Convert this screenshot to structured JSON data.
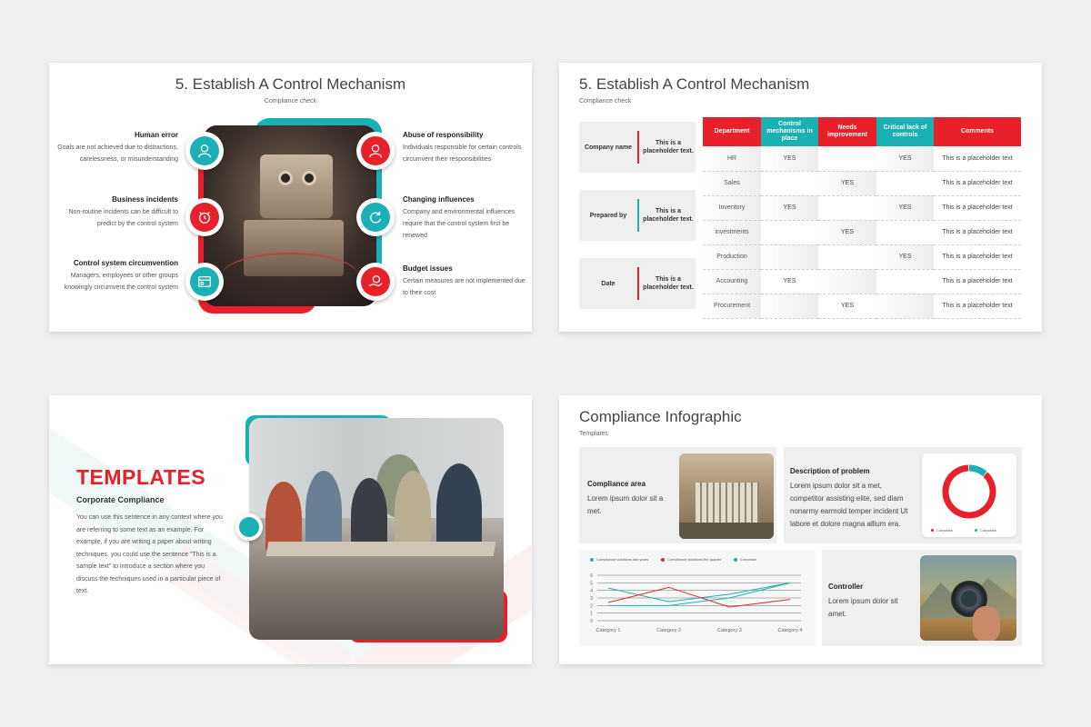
{
  "colors": {
    "teal": "#1ab0b4",
    "red": "#e8202a"
  },
  "slide1": {
    "title": "5. Establish A Control Mechanism",
    "subtitle": "Compliance check",
    "left_items": [
      {
        "heading": "Human error",
        "text": "Goals are not achieved due to distractions, carelessness, or misunderstanding",
        "icon": "person-icon"
      },
      {
        "heading": "Business incidents",
        "text": "Non-routine incidents can be difficult to predict by the control system",
        "icon": "alarm-icon"
      },
      {
        "heading": "Control system circumvention",
        "text": "Managers, employees or other groups knowingly circumvent the control system",
        "icon": "browser-icon"
      }
    ],
    "right_items": [
      {
        "heading": "Abuse of responsibility",
        "text": "Individuals responsible for certain controls circumvent their responsibilities",
        "icon": "person-icon"
      },
      {
        "heading": "Changing influences",
        "text": "Company and environmental influences require that the control system first be renewed",
        "icon": "refresh-icon"
      },
      {
        "heading": "Budget issues",
        "text": "Certain measures are not implemented due to their cost",
        "icon": "money-hand-icon"
      }
    ]
  },
  "slide2": {
    "title": "5. Establish A Control Mechanism",
    "subtitle": "Compliance check",
    "info_cards": [
      {
        "label": "Company name",
        "value": "This is a placeholder text."
      },
      {
        "label": "Prepared by",
        "value": "This is a placeholder text."
      },
      {
        "label": "Date",
        "value": "This is a placeholder text."
      }
    ],
    "table": {
      "headers": [
        "Department",
        "Control mechanisms in place",
        "Needs improvement",
        "Critical lack of controls",
        "Comments"
      ],
      "rows": [
        [
          "HR",
          "YES",
          "",
          "YES",
          "This is a placeholder text"
        ],
        [
          "Sales",
          "",
          "YES",
          "",
          "This is a placeholder text"
        ],
        [
          "Inventory",
          "YES",
          "",
          "YES",
          "This is a placeholder text"
        ],
        [
          "investments",
          "",
          "YES",
          "",
          "This is a placeholder text"
        ],
        [
          "Production",
          "",
          "",
          "YES",
          "This is a placeholder text"
        ],
        [
          "Accounting",
          "YES",
          "",
          "",
          "This is a placeholder text"
        ],
        [
          "Procurement",
          "",
          "YES",
          "",
          "This is a placeholder text"
        ]
      ]
    }
  },
  "slide3": {
    "heading": "TEMPLATES",
    "subheading": "Corporate Compliance",
    "body": "You can use this sentence in any context where you are referring to some text as an example. For example, if you are writing a paper about writing techniques, you could use the sentence \"This is a sample text\" to introduce a section where you discuss the techniques used in a particular piece of text."
  },
  "slide4": {
    "title": "Compliance Infographic",
    "subtitle": "Templates",
    "card_area": {
      "heading": "Compliance area",
      "text": "Lorem ipsum dolor sit a met."
    },
    "card_problem": {
      "heading": "Description of problem",
      "text": "Lorem ipsum dolor sit a met, competitor assisting elite, sed diam nonarmy earmold temper incident Ut labore et dolore magna allium era."
    },
    "card_controller": {
      "heading": "Controller",
      "text": "Lorem ipsum dolor sit amet."
    },
    "donut_legend": [
      "Corporate",
      "Corporate"
    ]
  },
  "chart_data": [
    {
      "type": "pie",
      "variant": "donut",
      "categories": [
        "Corporate",
        "Corporate"
      ],
      "values": [
        88,
        12
      ],
      "colors": [
        "#e8202a",
        "#1ab0b4"
      ],
      "legend_position": "bottom"
    },
    {
      "type": "line",
      "categories": [
        "Category 1",
        "Category 2",
        "Category 3",
        "Category 4"
      ],
      "series": [
        {
          "name": "Compliance violations last years",
          "values": [
            4.3,
            2.5,
            3.5,
            5.0
          ],
          "color": "#1ab0b4"
        },
        {
          "name": "Compliance violations the quarter",
          "values": [
            2.4,
            4.4,
            1.8,
            2.8
          ],
          "color": "#e8202a"
        },
        {
          "name": "Corporate",
          "values": [
            2.0,
            2.0,
            3.0,
            5.0
          ],
          "color": "#1ab0b4"
        }
      ],
      "yticks": [
        "0",
        "1",
        "2",
        "3",
        "4",
        "5",
        "6"
      ],
      "ylim": [
        0,
        6
      ],
      "grid": true,
      "legend_position": "top"
    }
  ]
}
